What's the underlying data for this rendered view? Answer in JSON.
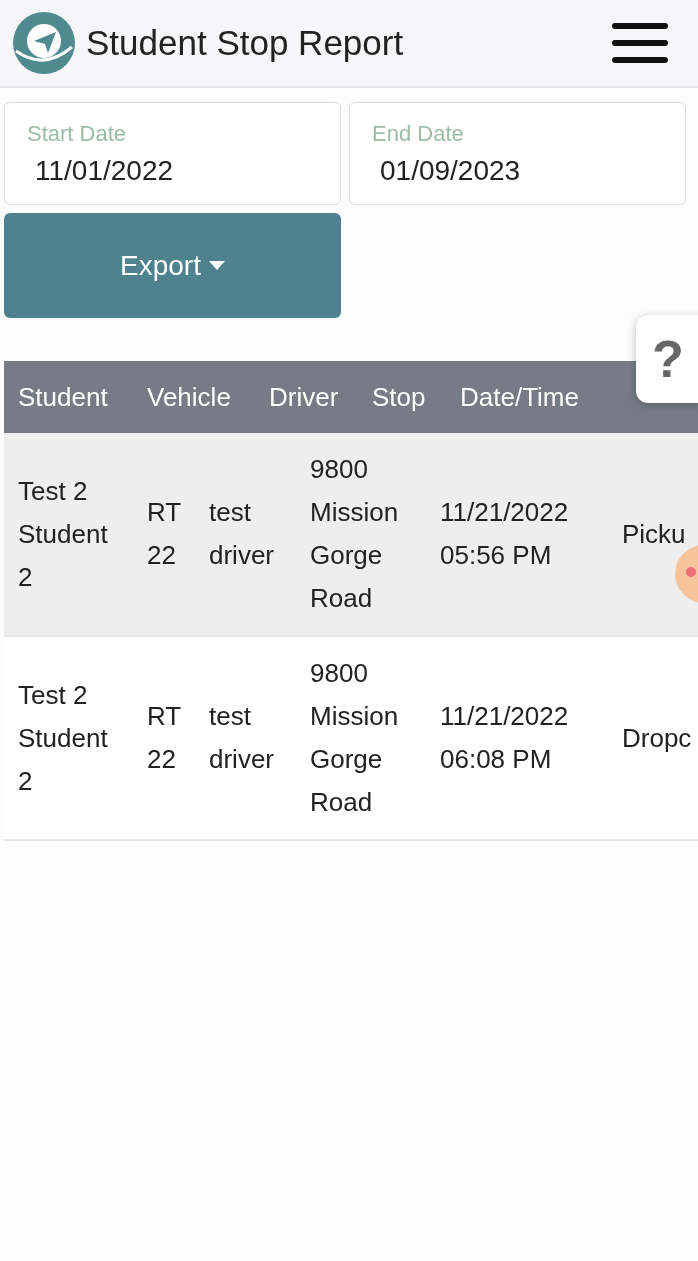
{
  "header": {
    "title": "Student Stop Report"
  },
  "filters": [
    {
      "label": "Start Date",
      "value": "11/01/2022"
    },
    {
      "label": "End Date",
      "value": "01/09/2023"
    }
  ],
  "export_button": {
    "label": "Export"
  },
  "help_button": {
    "label": "?"
  },
  "table": {
    "columns": [
      "Student",
      "Vehicle",
      "Driver",
      "Stop",
      "Date/Time"
    ],
    "rows": [
      {
        "striped": true,
        "cells": [
          "Test 2 Student 2",
          "RT 22",
          "test driver",
          "9800 Mission Gorge Road",
          "11/21/2022 05:56 PM",
          "Picku"
        ]
      },
      {
        "striped": false,
        "cells": [
          "Test 2 Student 2",
          "RT 22",
          "test driver",
          "9800 Mission Gorge Road",
          "11/21/2022 06:08 PM",
          "Dropc"
        ]
      }
    ]
  }
}
